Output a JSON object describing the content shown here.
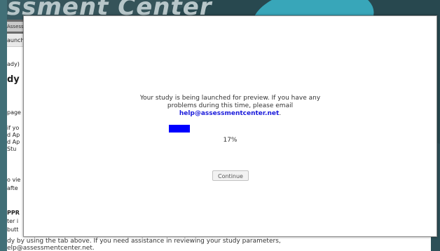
{
  "site": {
    "title": "ssment Center"
  },
  "background_page": {
    "tab_label": "Assessmen",
    "subnav_label": "aunch",
    "lines": [
      "ady)",
      "dy",
      "page",
      "if yo",
      "d Ap",
      "d Ap",
      "Stu",
      "o vie",
      "afte",
      "PPR",
      "ter i",
      "butt"
    ],
    "bottom_line_1": "dy by using the tab above. If you need assistance in reviewing your study parameters,",
    "bottom_line_2": "elp@assessmentcenter.net."
  },
  "modal": {
    "message_line_1": "Your study is being launched for preview. If you have any",
    "message_line_2": "problems during this time, please email",
    "email": "help@assessmentcenter.net",
    "email_suffix": ".",
    "progress_percent": 17,
    "progress_label": "17%",
    "continue_label": "Continue"
  },
  "colors": {
    "backdrop": "#2d5058",
    "accent_teal": "#38a6b9",
    "progress_fill": "#0000ff",
    "link": "#1a1adb"
  }
}
